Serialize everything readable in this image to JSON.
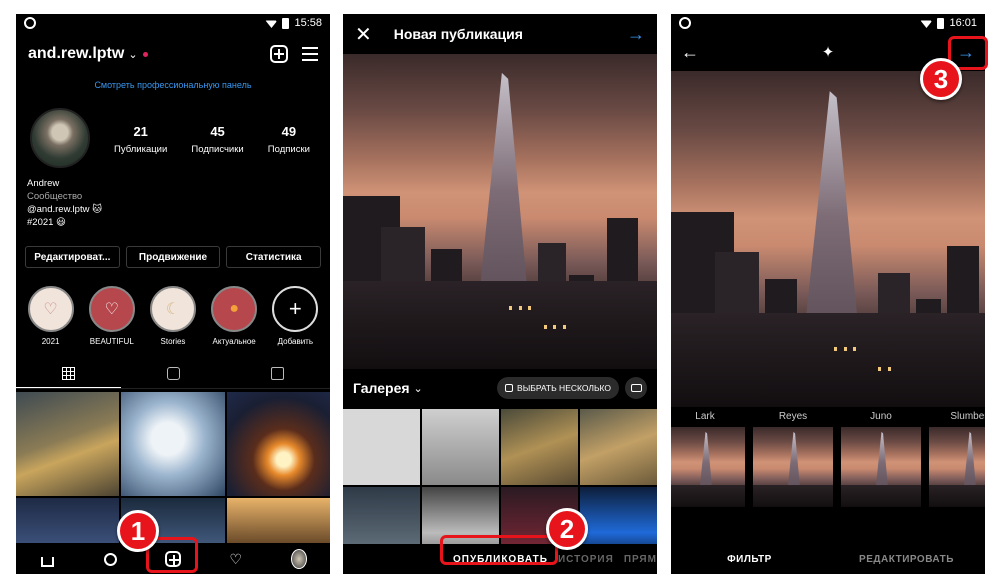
{
  "panel1": {
    "status_time": "15:58",
    "username": "and.rew.lptw",
    "pro_link": "Смотреть профессиональную панель",
    "stats": [
      {
        "num": "21",
        "label": "Публикации"
      },
      {
        "num": "45",
        "label": "Подписчики"
      },
      {
        "num": "49",
        "label": "Подписки"
      }
    ],
    "bio": {
      "name": "Andrew",
      "category": "Сообщество",
      "handle": "@and.rew.lptw 🐱",
      "tag": "#2021 😃"
    },
    "buttons": [
      "Редактироват...",
      "Продвижение",
      "Статистика"
    ],
    "highlights": [
      "2021",
      "BEAUTIFUL",
      "Stories",
      "Актуальное",
      "Добавить"
    ],
    "step_badge": "1"
  },
  "panel2": {
    "title": "Новая публикация",
    "gallery_label": "Галерея",
    "select_multiple": "ВЫБРАТЬ НЕСКОЛЬКО",
    "bottom_tabs": [
      "ОПУБЛИКОВАТЬ",
      "ИСТОРИЯ",
      "ПРЯМ"
    ],
    "step_badge": "2"
  },
  "panel3": {
    "status_time": "16:01",
    "filters": [
      "Lark",
      "Reyes",
      "Juno",
      "Slumber"
    ],
    "bottom_tabs": [
      "ФИЛЬТР",
      "РЕДАКТИРОВАТЬ"
    ],
    "step_badge": "3"
  },
  "colors": {
    "accent_blue": "#3897f0",
    "callout_red": "#e8141b",
    "background": "#000000"
  }
}
